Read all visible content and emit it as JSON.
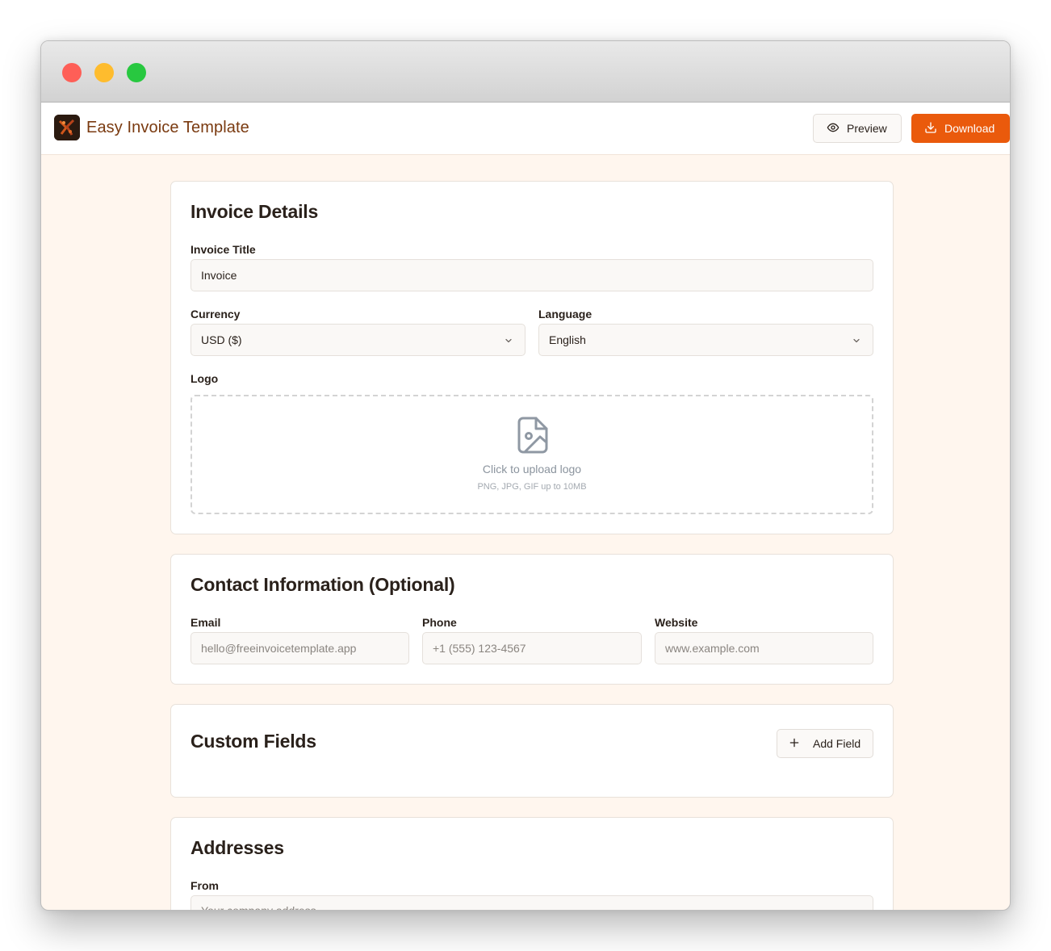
{
  "app": {
    "brand": "Easy Invoice Template",
    "preview_label": "Preview",
    "download_label": "Download",
    "accent_color": "#ea5a0c"
  },
  "invoice_details": {
    "heading": "Invoice Details",
    "title_label": "Invoice Title",
    "title_value": "Invoice",
    "currency_label": "Currency",
    "currency_value": "USD ($)",
    "language_label": "Language",
    "language_value": "English",
    "logo_label": "Logo",
    "upload_text": "Click to upload logo",
    "upload_hint": "PNG, JPG, GIF up to 10MB"
  },
  "contact": {
    "heading": "Contact Information (Optional)",
    "email_label": "Email",
    "email_placeholder": "hello@freeinvoicetemplate.app",
    "phone_label": "Phone",
    "phone_placeholder": "+1 (555) 123-4567",
    "website_label": "Website",
    "website_placeholder": "www.example.com"
  },
  "custom_fields": {
    "heading": "Custom Fields",
    "add_label": "Add Field"
  },
  "addresses": {
    "heading": "Addresses",
    "from_label": "From",
    "from_placeholder": "Your company address"
  },
  "icons": {
    "preview": "eye-icon",
    "download": "download-icon",
    "upload": "image-file-icon",
    "select": "chevron-down-icon",
    "add": "plus-icon"
  }
}
